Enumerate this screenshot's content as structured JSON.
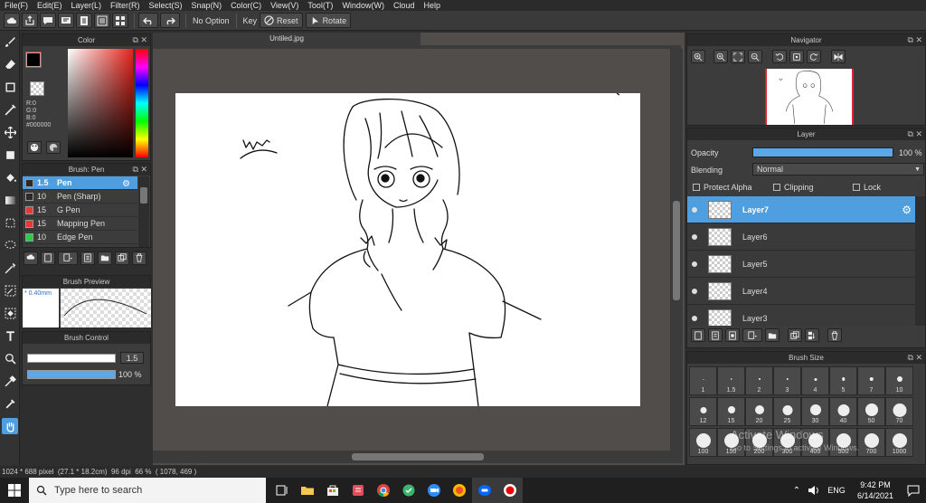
{
  "menu": [
    "File(F)",
    "Edit(E)",
    "Layer(L)",
    "Filter(R)",
    "Select(S)",
    "Snap(N)",
    "Color(C)",
    "View(V)",
    "Tool(T)",
    "Window(W)",
    "Cloud",
    "Help"
  ],
  "toolbar": {
    "no_option": "No Option",
    "key": "Key",
    "reset": "Reset",
    "rotate": "Rotate"
  },
  "color_panel": {
    "title": "Color",
    "r": "R:0",
    "g": "G:0",
    "b": "B:0",
    "hex": "#000000",
    "primary": "#000000",
    "secondary": "#ffffff",
    "accent": "#e53935"
  },
  "brush_panel": {
    "title": "Brush: Pen",
    "items": [
      {
        "size": "1.5",
        "name": "Pen",
        "color": "#2a2a2a",
        "selected": true
      },
      {
        "size": "10",
        "name": "Pen (Sharp)",
        "color": "#2a2a2a",
        "selected": false
      },
      {
        "size": "15",
        "name": "G Pen",
        "color": "#e53935",
        "selected": false
      },
      {
        "size": "15",
        "name": "Mapping Pen",
        "color": "#e53935",
        "selected": false
      },
      {
        "size": "10",
        "name": "Edge Pen",
        "color": "#2ecc40",
        "selected": false
      }
    ]
  },
  "brush_preview": {
    "title": "Brush Preview",
    "size": "* 0.40mm"
  },
  "brush_control": {
    "title": "Brush Control",
    "size_value": "1.5",
    "opacity_value": "100 %"
  },
  "canvas": {
    "tab_title": "Untiled.jpg"
  },
  "navigator": {
    "title": "Navigator"
  },
  "layer_panel": {
    "title": "Layer",
    "opacity_label": "Opacity",
    "opacity_value": "100 %",
    "opacity_fraction": 1.0,
    "blending_label": "Blending",
    "blending_value": "Normal",
    "protect_alpha": "Protect Alpha",
    "clipping": "Clipping",
    "lock": "Lock",
    "layers": [
      {
        "name": "Layer7",
        "selected": true
      },
      {
        "name": "Layer6",
        "selected": false
      },
      {
        "name": "Layer5",
        "selected": false
      },
      {
        "name": "Layer4",
        "selected": false
      },
      {
        "name": "Layer3",
        "selected": false
      }
    ]
  },
  "brush_size": {
    "title": "Brush Size",
    "sizes": [
      "1",
      "1.5",
      "2",
      "3",
      "4",
      "5",
      "7",
      "10",
      "12",
      "15",
      "20",
      "25",
      "30",
      "40",
      "50",
      "70",
      "100",
      "150",
      "200",
      "300",
      "400",
      "500",
      "700",
      "1000"
    ]
  },
  "watermark": {
    "line1": "Activate Windows",
    "line2": "Go to Settings to activate Windows."
  },
  "status": {
    "text": "1024 * 688 pixel  (27.1 * 18.2cm)  96 dpi  66 %  ( 1078, 469 )"
  },
  "taskbar": {
    "search_placeholder": "Type here to search",
    "lang": "ENG",
    "time": "9:42 PM",
    "date": "6/14/2021"
  }
}
